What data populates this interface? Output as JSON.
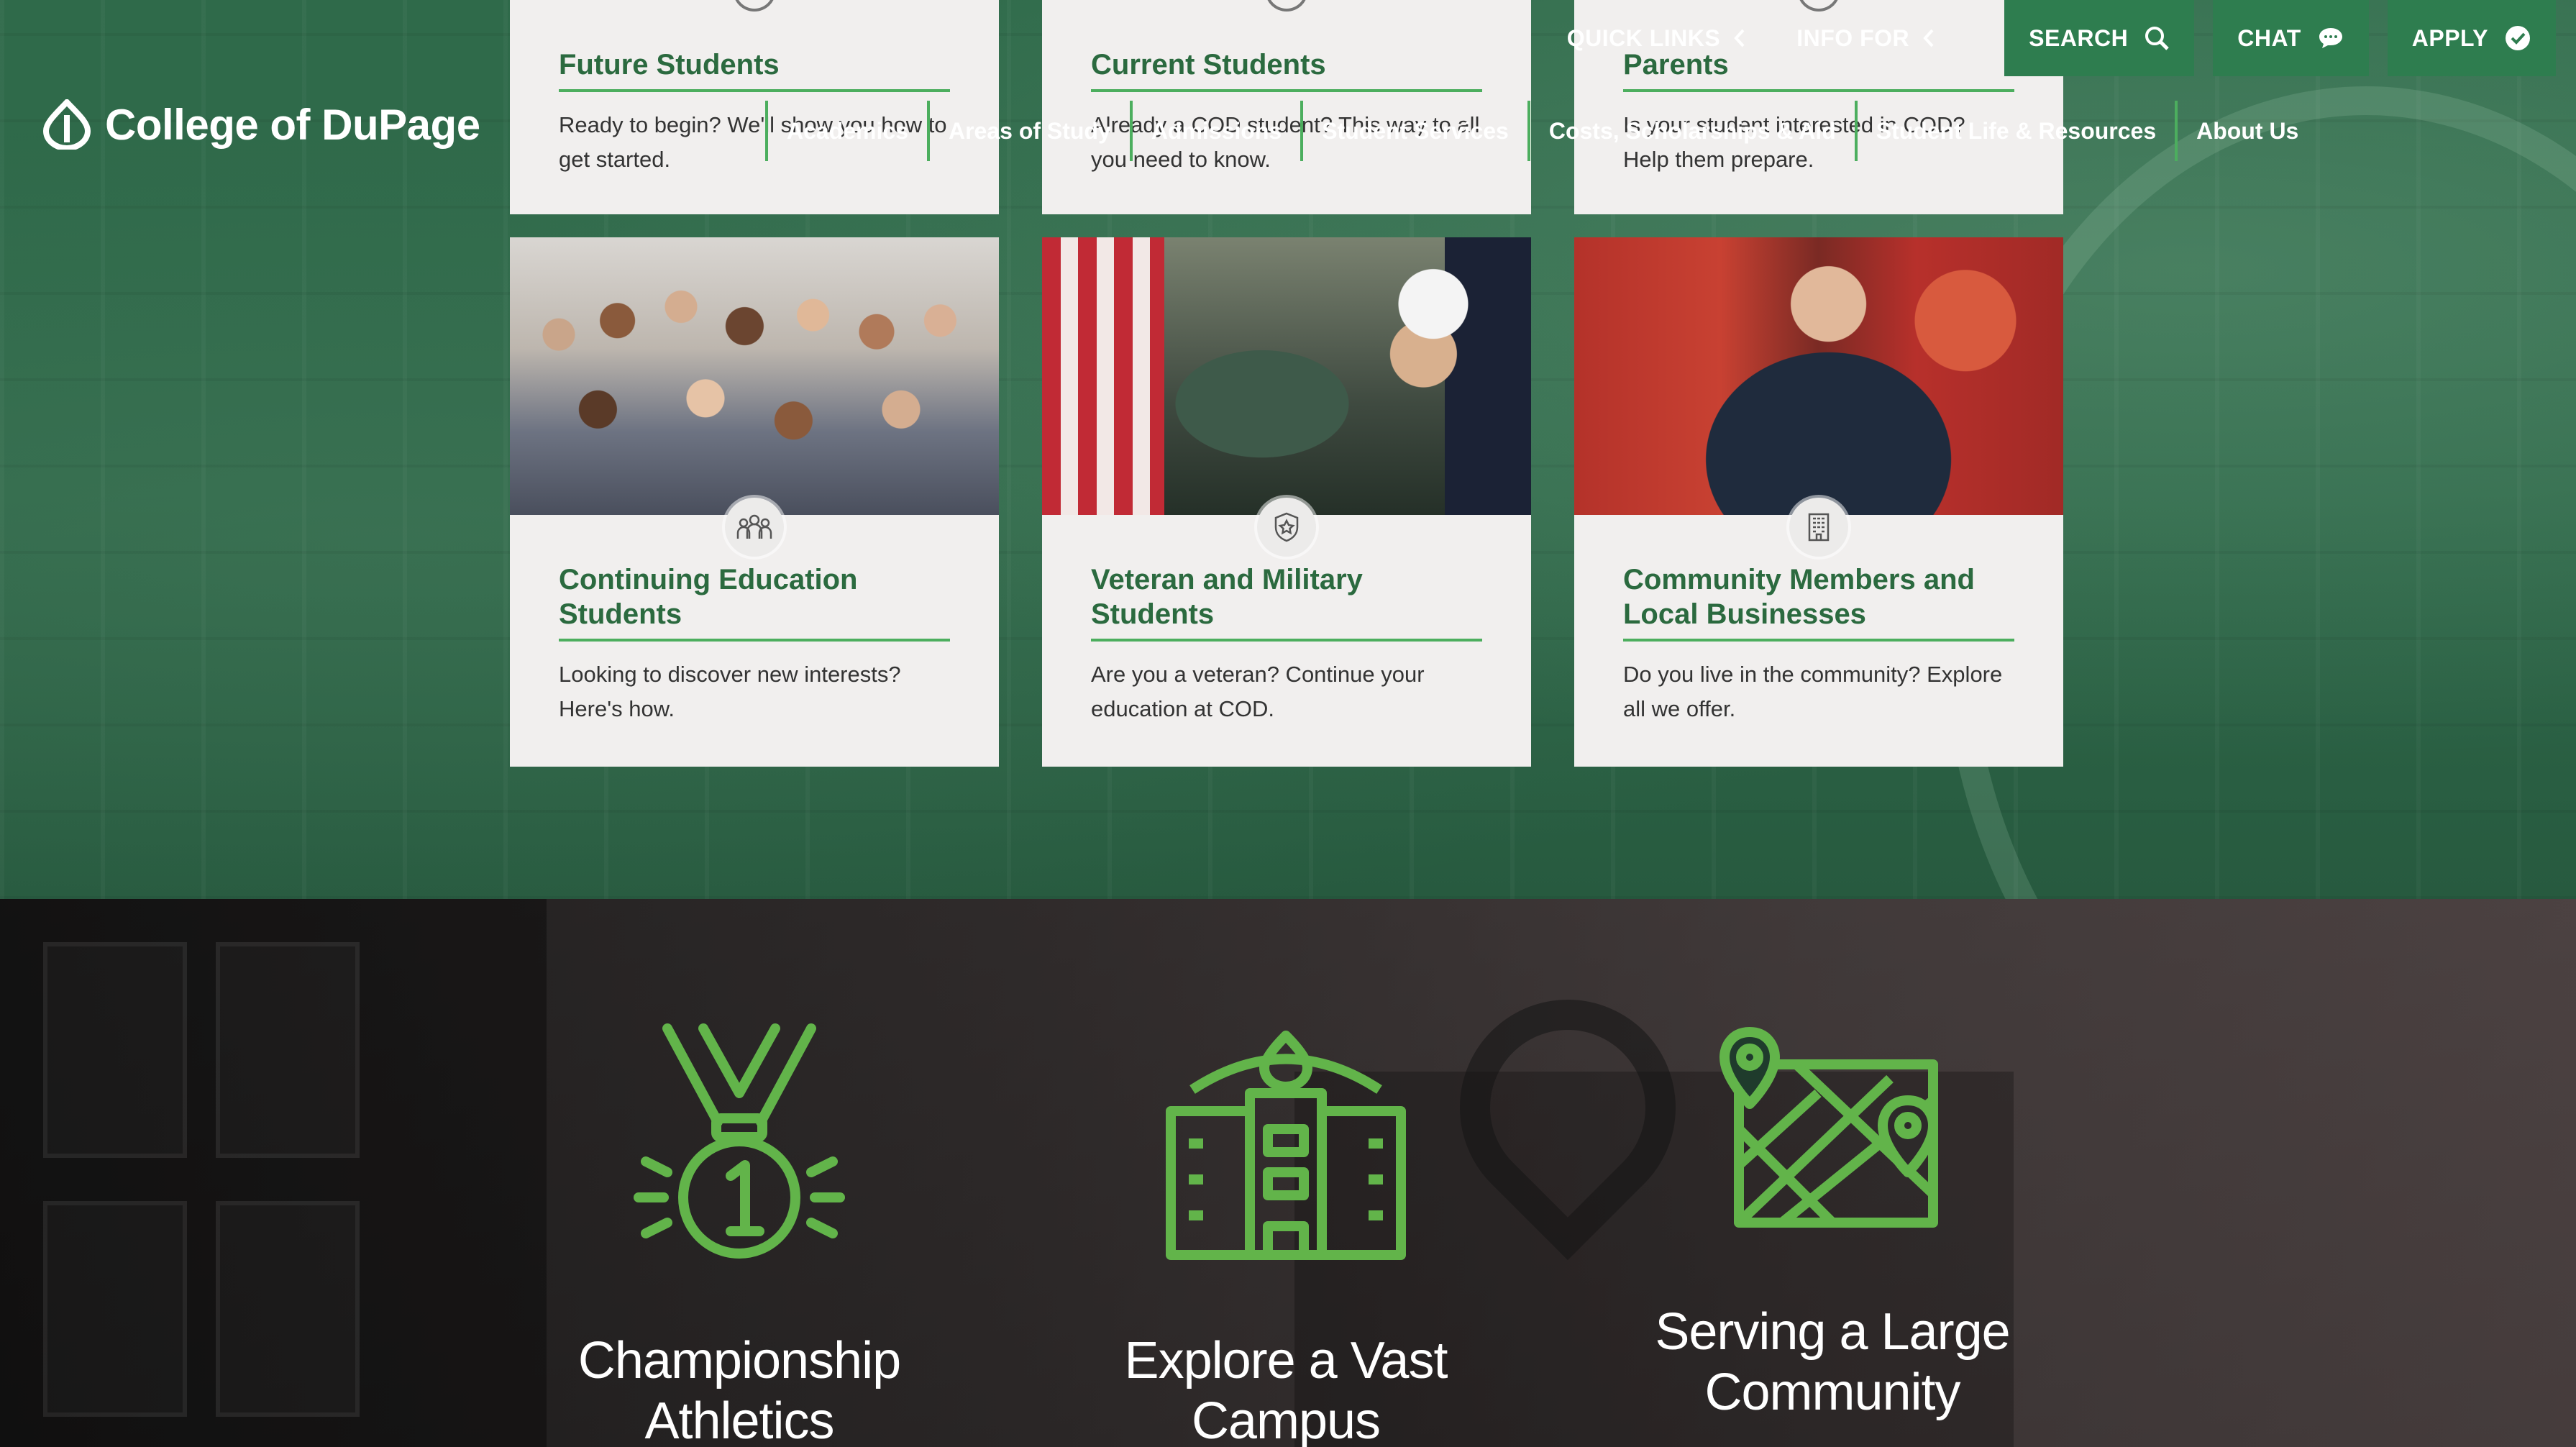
{
  "brand": {
    "name": "College of DuPage"
  },
  "utility_nav": {
    "quick_links": "QUICK LINKS",
    "info_for": "INFO FOR",
    "search": "SEARCH",
    "chat": "CHAT",
    "apply": "APPLY"
  },
  "main_nav": [
    {
      "label": "Academics"
    },
    {
      "label": "Areas of Study"
    },
    {
      "label": "Admissions"
    },
    {
      "label": "Student Services"
    },
    {
      "label": "Costs, Scholarships & Aid"
    },
    {
      "label": "Student Life & Resources"
    },
    {
      "label": "About Us"
    }
  ],
  "audience_cards_top": [
    {
      "title": "Future Students",
      "description": "Ready to begin? We'll show you how to get started.",
      "icon": "graduate-icon"
    },
    {
      "title": "Current Students",
      "description": "Already a COD student? This way to all you need to know.",
      "icon": "book-icon"
    },
    {
      "title": "Parents",
      "description": "Is your student interested in COD? Help them prepare.",
      "icon": "people-icon"
    }
  ],
  "audience_cards_bottom": [
    {
      "title": "Continuing Education Students",
      "description": "Looking to discover new interests? Here's how.",
      "icon": "group-icon"
    },
    {
      "title": "Veteran and Military Students",
      "description": "Are you a veteran? Continue your education at COD.",
      "icon": "military-badge-icon"
    },
    {
      "title": "Community Members and Local Businesses",
      "description": "Do you live in the community? Explore all we offer.",
      "icon": "building-icon"
    }
  ],
  "stats": [
    {
      "label": "Championship Athletics",
      "icon": "medal-icon"
    },
    {
      "label": "Explore a Vast Campus",
      "icon": "campus-building-icon"
    },
    {
      "label": "Serving a Large Community",
      "icon": "map-icon"
    }
  ],
  "colors": {
    "brand_green": "#2e7d4f",
    "accent_green": "#4cae5e",
    "title_green": "#2b6a3f",
    "icon_green": "#62b44a"
  }
}
